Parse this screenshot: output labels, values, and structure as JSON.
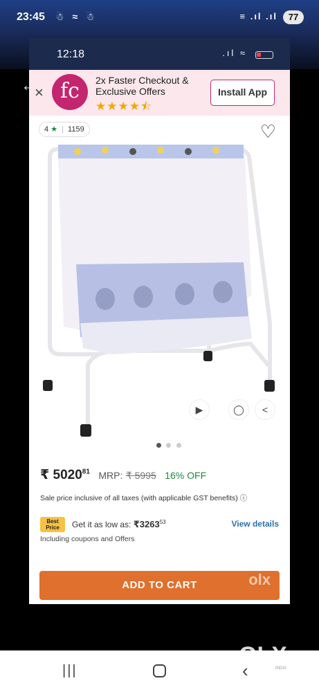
{
  "outer_status": {
    "time": "23:45",
    "left_icons": "☃ ≈ ☃",
    "right_icons": "≡ .ıl .ıl",
    "battery": "77"
  },
  "inner_status": {
    "time": "12:18",
    "signal": ".ıl ≈"
  },
  "promo": {
    "logo_text": "fc",
    "title": "2x Faster Checkout & Exclusive Offers",
    "stars": "★★★★⯪",
    "rating_value": 4.5,
    "install_label": "Install App"
  },
  "product": {
    "rating": "4",
    "rating_count": "1159",
    "image_count": 3,
    "active_image": 1
  },
  "price": {
    "currency": "₹",
    "sale_main": "5020",
    "sale_paise": "81",
    "mrp_label": "MRP:",
    "mrp": "₹ 5995",
    "discount": "16% OFF",
    "tax_note": "Sale price inclusive of all taxes (with applicable GST benefits) ⓘ"
  },
  "best_price": {
    "badge_line1": "Best",
    "badge_line2": "Price",
    "label": "Get it as low as:",
    "amount": "₹3263",
    "amount_paise": "53",
    "view_details": "View details",
    "note": "Including coupons and Offers"
  },
  "cta": {
    "add_to_cart": "ADD TO CART",
    "watermark": "olx"
  },
  "watermark": {
    "logo": "OLX",
    "sub": "INDIA"
  },
  "colors": {
    "brand": "#c4256f",
    "cta": "#e0702e",
    "discount": "#1a8a3a",
    "link": "#2b6fb3"
  }
}
